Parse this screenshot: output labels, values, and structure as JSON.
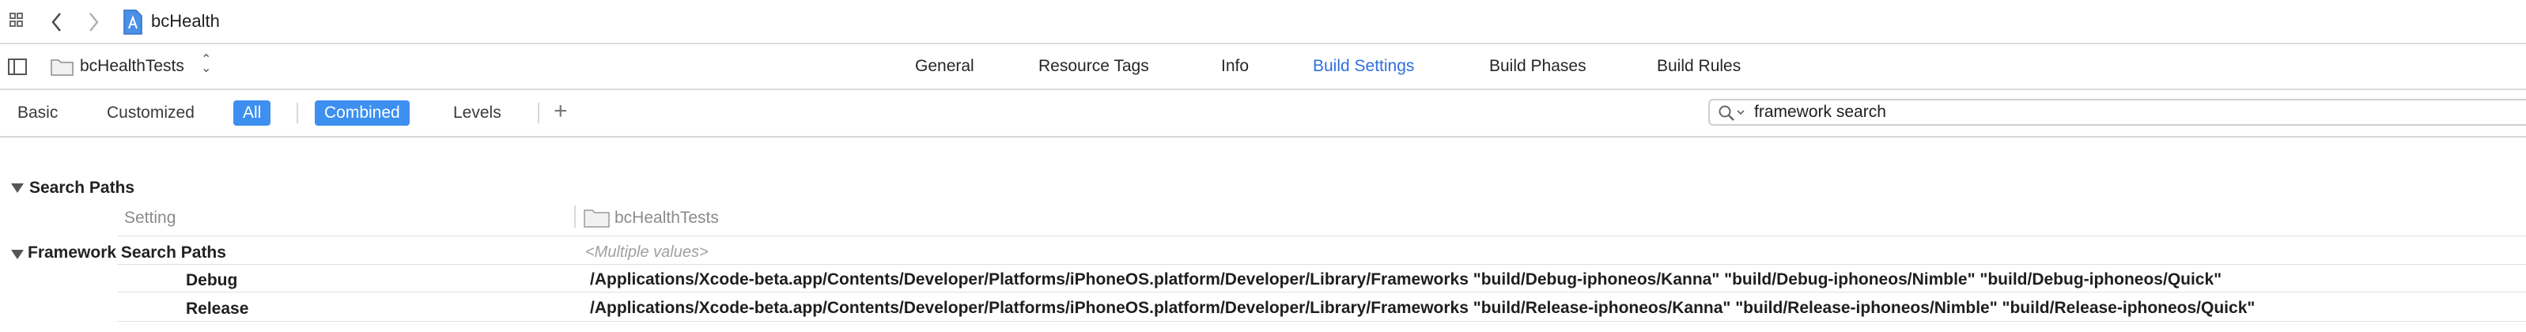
{
  "jumpbar": {
    "project_name": "bcHealth",
    "icons": [
      "grid-icon",
      "back-arrow-icon",
      "forward-arrow-icon",
      "project-file-icon"
    ]
  },
  "tabbar": {
    "target": "bcHealthTests",
    "tabs": [
      "General",
      "Resource Tags",
      "Info",
      "Build Settings",
      "Build Phases",
      "Build Rules"
    ],
    "active_tab": "Build Settings"
  },
  "filterbar": {
    "basic": "Basic",
    "customized": "Customized",
    "all": "All",
    "combined": "Combined",
    "levels": "Levels",
    "search_value": "framework search"
  },
  "content": {
    "section_title": "Search Paths",
    "header_setting": "Setting",
    "header_target": "bcHealthTests",
    "setting_name": "Framework Search Paths",
    "multiple_values": "<Multiple values>",
    "configs": [
      {
        "name": "Debug",
        "value": "/Applications/Xcode-beta.app/Contents/Developer/Platforms/iPhoneOS.platform/Developer/Library/Frameworks \"build/Debug-iphoneos/Kanna\" \"build/Debug-iphoneos/Nimble\" \"build/Debug-iphoneos/Quick\""
      },
      {
        "name": "Release",
        "value": "/Applications/Xcode-beta.app/Contents/Developer/Platforms/iPhoneOS.platform/Developer/Library/Frameworks \"build/Release-iphoneos/Kanna\" \"build/Release-iphoneos/Nimble\" \"build/Release-iphoneos/Quick\""
      }
    ]
  },
  "colors": {
    "accent": "#3d8ff0",
    "active_tab": "#2e6fdb"
  }
}
